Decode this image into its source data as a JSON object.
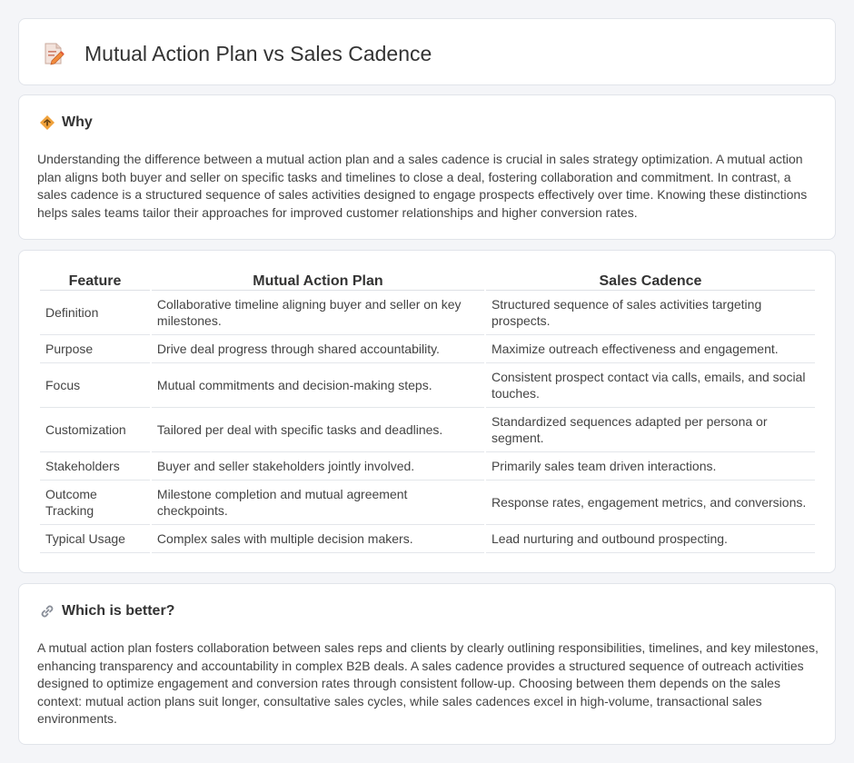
{
  "header": {
    "title": "Mutual Action Plan vs Sales Cadence",
    "icon": "document-pencil-icon"
  },
  "why": {
    "title": "Why",
    "icon": "diamond-signal-icon",
    "text": "Understanding the difference between a mutual action plan and a sales cadence is crucial in sales strategy optimization. A mutual action plan aligns both buyer and seller on specific tasks and timelines to close a deal, fostering collaboration and commitment. In contrast, a sales cadence is a structured sequence of sales activities designed to engage prospects effectively over time. Knowing these distinctions helps sales teams tailor their approaches for improved customer relationships and higher conversion rates."
  },
  "table": {
    "headers": [
      "Feature",
      "Mutual Action Plan",
      "Sales Cadence"
    ],
    "rows": [
      [
        "Definition",
        "Collaborative timeline aligning buyer and seller on key milestones.",
        "Structured sequence of sales activities targeting prospects."
      ],
      [
        "Purpose",
        "Drive deal progress through shared accountability.",
        "Maximize outreach effectiveness and engagement."
      ],
      [
        "Focus",
        "Mutual commitments and decision-making steps.",
        "Consistent prospect contact via calls, emails, and social touches."
      ],
      [
        "Customization",
        "Tailored per deal with specific tasks and deadlines.",
        "Standardized sequences adapted per persona or segment."
      ],
      [
        "Stakeholders",
        "Buyer and seller stakeholders jointly involved.",
        "Primarily sales team driven interactions."
      ],
      [
        "Outcome Tracking",
        "Milestone completion and mutual agreement checkpoints.",
        "Response rates, engagement metrics, and conversions."
      ],
      [
        "Typical Usage",
        "Complex sales with multiple decision makers.",
        "Lead nurturing and outbound prospecting."
      ]
    ]
  },
  "better": {
    "title": "Which is better?",
    "icon": "link-icon",
    "text": "A mutual action plan fosters collaboration between sales reps and clients by clearly outlining responsibilities, timelines, and key milestones, enhancing transparency and accountability in complex B2B deals. A sales cadence provides a structured sequence of outreach activities designed to optimize engagement and conversion rates through consistent follow-up. Choosing between them depends on the sales context: mutual action plans suit longer, consultative sales cycles, while sales cadences excel in high-volume, transactional sales environments."
  },
  "colors": {
    "accent_orange": "#f0a23c",
    "background": "#f4f5f8",
    "card": "#ffffff"
  }
}
